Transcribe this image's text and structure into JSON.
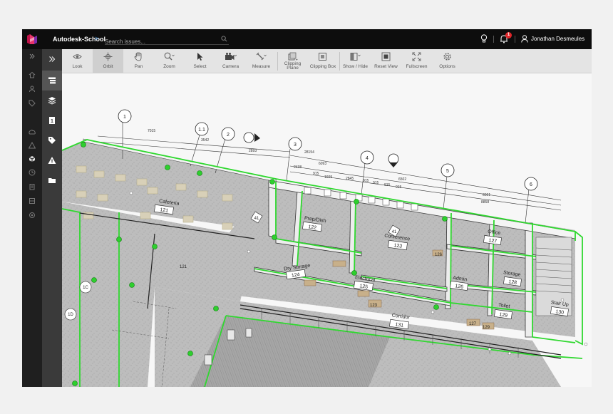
{
  "header": {
    "project": "Autodesk-School",
    "search_placeholder": "Search issues...",
    "notification_count": "1",
    "user_name": "Jonathan Desmeules"
  },
  "toolbar": {
    "look": "Look",
    "orbit": "Orbit",
    "pan": "Pan",
    "zoom": "Zoom",
    "select": "Select",
    "camera": "Camera",
    "measure": "Measure",
    "clipping_plane": "Clipping Plane",
    "clipping_box": "Clipping Box",
    "show_hide": "Show / Hide",
    "reset_view": "Reset View",
    "fullscreen": "Fullscreen",
    "options": "Options"
  },
  "model": {
    "grid_bubbles": [
      "1",
      "1.1",
      "2",
      "3",
      "4",
      "5",
      "6"
    ],
    "dimensions": [
      "7015",
      "3542",
      "2893",
      "28154",
      "2438",
      "6093",
      "915",
      "1609",
      "2845",
      "915",
      "915",
      "915",
      "915",
      "6502",
      "6501",
      "8858"
    ],
    "rooms": [
      {
        "name": "Cafeteria",
        "number": "121"
      },
      {
        "name": "Prep/Dish",
        "number": "122"
      },
      {
        "name": "Conference",
        "number": "123"
      },
      {
        "name": "Dry Storage",
        "number": "124"
      },
      {
        "name": "Electrical",
        "number": "125"
      },
      {
        "name": "Admin",
        "number": "126"
      },
      {
        "name": "Office",
        "number": "127"
      },
      {
        "name": "Storage",
        "number": "128"
      },
      {
        "name": "Toilet",
        "number": "129"
      },
      {
        "name": "Stair Up",
        "number": "130"
      },
      {
        "name": "Corridor",
        "number": "131"
      }
    ],
    "tags": [
      "41",
      "41",
      "123",
      "129",
      "127",
      "126",
      "1C",
      "1D",
      "121"
    ]
  }
}
